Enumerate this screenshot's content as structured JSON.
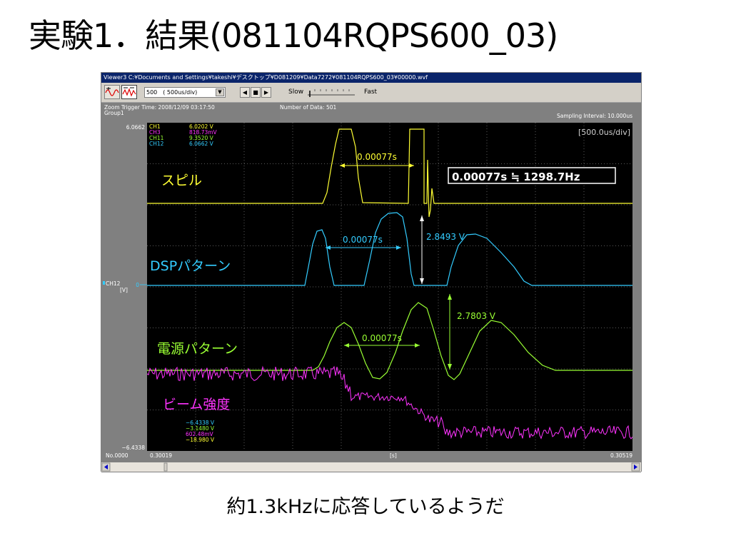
{
  "slide": {
    "title": "実験1．結果(081104RQPS600_03)",
    "caption": "約1.3kHzに応答しているようだ"
  },
  "viewer": {
    "window_title": "Viewer3 C:¥Documents and Settings¥takeshi¥デスクトップ¥D081209¥Data7272¥081104RQPS600_03¥00000.wvf",
    "toolbar": {
      "points_value": "500",
      "time_div_select": "500　( 500us/div)",
      "slow_label": "Slow",
      "fast_label": "Fast"
    },
    "header": {
      "zoom_trigger": "Zoom Trigger Time: 2008/12/09 03:17:50",
      "group": "Group1",
      "number_of_data": "Number of Data: 501",
      "sampling_interval": "Sampling Interval: 10.000us",
      "time_div": "[500.0us/div]"
    },
    "y_axis": {
      "top": "6.0662",
      "bottom": "−6.4338",
      "zero": "0",
      "channel": "CH12",
      "unit": "[V]"
    },
    "channels_top": [
      {
        "name": "CH1",
        "value": "6.0202 V",
        "color": "#ffff33"
      },
      {
        "name": "CH3",
        "value": "818.73mV",
        "color": "#ff33ff"
      },
      {
        "name": "CH11",
        "value": "9.3520 V",
        "color": "#99ff33"
      },
      {
        "name": "CH12",
        "value": "6.0662 V",
        "color": "#33ccff"
      }
    ],
    "channels_bottom": [
      {
        "value": "−6.4338 V",
        "color": "#33ccff"
      },
      {
        "value": "−3.1480 V",
        "color": "#99ff33"
      },
      {
        "value": "602.48mV",
        "color": "#ff33ff"
      },
      {
        "value": "−18.980 V",
        "color": "#ffff33"
      }
    ],
    "x_axis": {
      "start": "0.30019",
      "end": "0.30519",
      "unit": "[s]",
      "record": "No.0000"
    },
    "annotations": {
      "spill_label": "スピル",
      "dsp_label": "DSPパターン",
      "power_label": "電源パターン",
      "beam_label": "ビーム強度",
      "interval_spill": "0.00077s",
      "interval_dsp": "0.00077s",
      "interval_power": "0.00077s",
      "freq_box": "0.00077s ≒ 1298.7Hz",
      "dsp_amplitude": "2.8493 V",
      "power_amplitude": "2.7803 V"
    },
    "colors": {
      "spill": "#ffff33",
      "dsp": "#33ccff",
      "power": "#99ff33",
      "beam": "#ff33ff",
      "grid": "#5a5a5a"
    }
  }
}
